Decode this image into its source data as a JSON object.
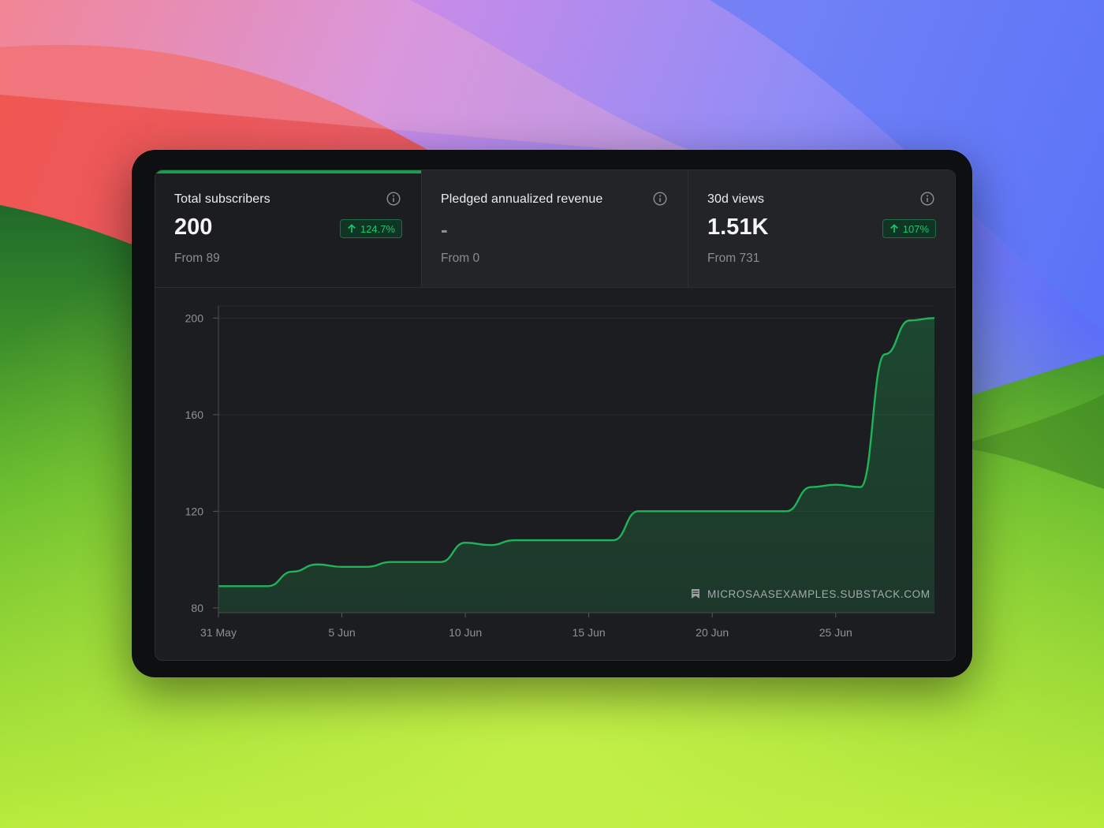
{
  "colors": {
    "accent": "#1e9a4e",
    "accent_line": "#20b35a",
    "panel_bg": "#1c1d20",
    "badge_text": "#25c46c"
  },
  "stats": [
    {
      "title": "Total subscribers",
      "value": "200",
      "from": "From 89",
      "badge": "124.7%",
      "badge_icon": "arrow-up-icon",
      "info_icon": "info-icon",
      "active": true
    },
    {
      "title": "Pledged annualized revenue",
      "value": "-",
      "from": "From 0",
      "badge": null,
      "info_icon": "info-icon",
      "active": false
    },
    {
      "title": "30d views",
      "value": "1.51K",
      "from": "From 731",
      "badge": "107%",
      "badge_icon": "arrow-up-icon",
      "info_icon": "info-icon",
      "active": false
    }
  ],
  "watermark": {
    "icon": "bookmark-icon",
    "text": "MICROSAASEXAMPLES.SUBSTACK.COM"
  },
  "chart_data": {
    "type": "area",
    "series": [
      {
        "x": [
          "31 May",
          "1 Jun",
          "2 Jun",
          "3 Jun",
          "4 Jun",
          "5 Jun",
          "6 Jun",
          "7 Jun",
          "8 Jun",
          "9 Jun",
          "10 Jun",
          "11 Jun",
          "12 Jun",
          "13 Jun",
          "14 Jun",
          "15 Jun",
          "16 Jun",
          "17 Jun",
          "18 Jun",
          "19 Jun",
          "20 Jun",
          "21 Jun",
          "22 Jun",
          "23 Jun",
          "24 Jun",
          "25 Jun",
          "26 Jun",
          "27 Jun",
          "28 Jun",
          "29 Jun"
        ],
        "values": [
          89,
          89,
          89,
          95,
          98,
          97,
          97,
          99,
          99,
          99,
          107,
          106,
          108,
          108,
          108,
          108,
          108,
          120,
          120,
          120,
          120,
          120,
          120,
          120,
          130,
          131,
          130,
          185,
          199,
          200
        ]
      }
    ],
    "xticks": [
      "31 May",
      "5 Jun",
      "10 Jun",
      "15 Jun",
      "20 Jun",
      "25 Jun"
    ],
    "yticks": [
      80,
      120,
      160,
      200
    ],
    "ylim": [
      78,
      205
    ],
    "grid": true
  }
}
